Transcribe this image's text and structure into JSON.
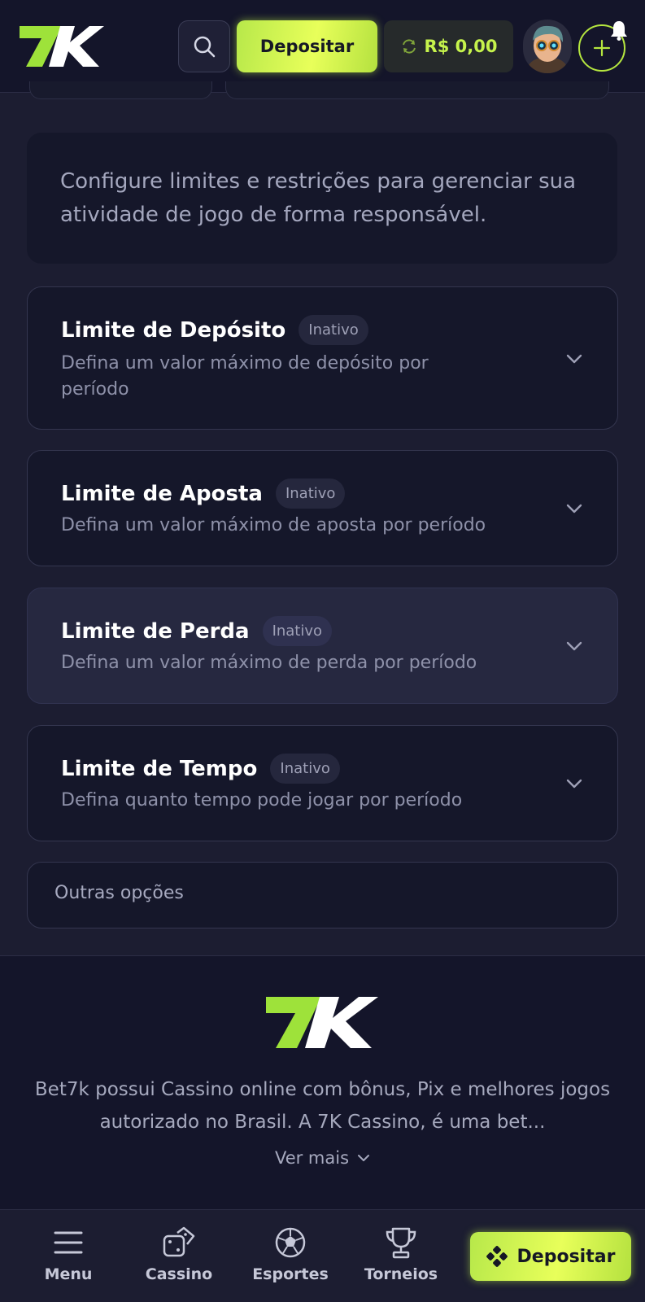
{
  "header": {
    "logo_text": "7K",
    "search_icon": "search-icon",
    "deposit_label": "Depositar",
    "balance_label": "R$ 0,00",
    "refresh_icon": "refresh-icon",
    "add_icon": "plus-icon",
    "notification_icon": "bell-icon"
  },
  "intro": {
    "text": "Configure limites e restrições para gerenciar sua atividade de jogo de forma responsável."
  },
  "limits": [
    {
      "title": "Limite de Depósito",
      "badge": "Inativo",
      "description": "Defina um valor máximo de depósito por período"
    },
    {
      "title": "Limite de Aposta",
      "badge": "Inativo",
      "description": "Defina um valor máximo de aposta por período"
    },
    {
      "title": "Limite de Perda",
      "badge": "Inativo",
      "description": "Defina um valor máximo de perda por período"
    },
    {
      "title": "Limite de Tempo",
      "badge": "Inativo",
      "description": "Defina quanto tempo pode jogar por período"
    }
  ],
  "other_options": {
    "label": "Outras opções"
  },
  "footer": {
    "logo_text": "7K",
    "text": "Bet7k possui Cassino online com bônus, Pix e melhores jogos autorizado no Brasil. A 7K Cassino, é uma bet...",
    "see_more": "Ver mais"
  },
  "bottom_nav": {
    "items": [
      {
        "label": "Menu",
        "icon": "menu-icon"
      },
      {
        "label": "Cassino",
        "icon": "dice-icon"
      },
      {
        "label": "Esportes",
        "icon": "soccer-ball-icon"
      },
      {
        "label": "Torneios",
        "icon": "trophy-icon"
      }
    ],
    "deposit_label": "Depositar",
    "deposit_icon": "clover-icon"
  },
  "colors": {
    "accent": "#c6f34c",
    "background": "#1c1d31",
    "card": "#15172a",
    "header": "#14152a"
  }
}
